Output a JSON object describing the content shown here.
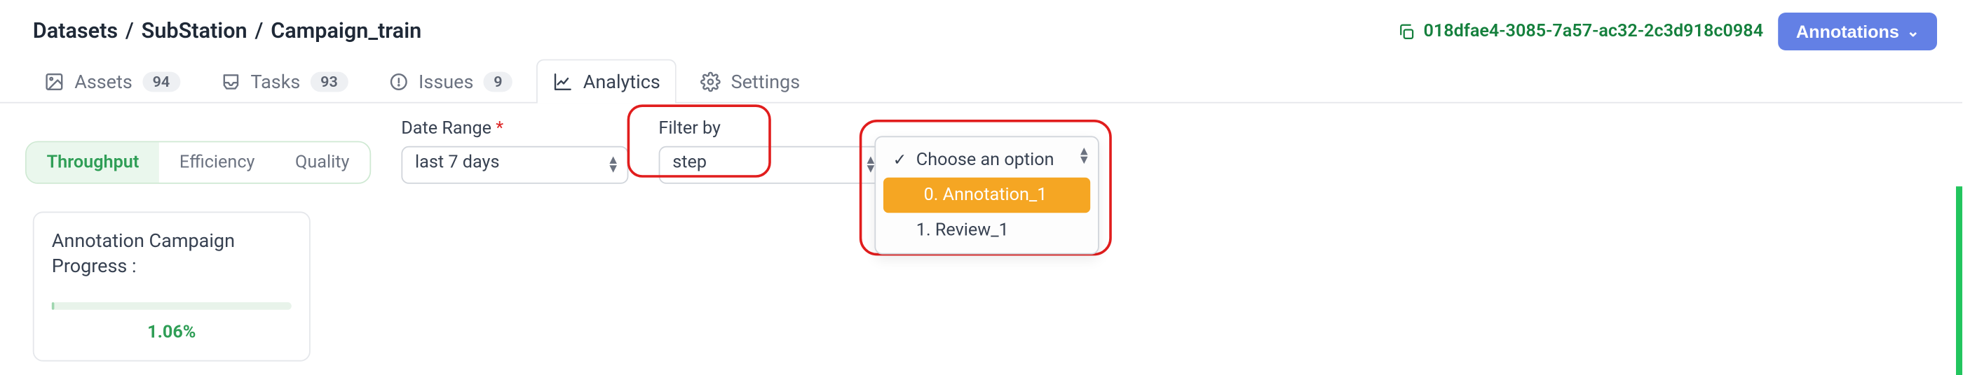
{
  "breadcrumb": {
    "root": "Datasets",
    "mid": "SubStation",
    "leaf": "Campaign_train"
  },
  "header": {
    "uuid": "018dfae4-3085-7a57-ac32-2c3d918c0984",
    "annotations_btn": "Annotations"
  },
  "tabs": {
    "assets": {
      "label": "Assets",
      "count": "94"
    },
    "tasks": {
      "label": "Tasks",
      "count": "93"
    },
    "issues": {
      "label": "Issues",
      "count": "9"
    },
    "analytics": {
      "label": "Analytics"
    },
    "settings": {
      "label": "Settings"
    }
  },
  "seg": {
    "throughput": "Throughput",
    "efficiency": "Efficiency",
    "quality": "Quality"
  },
  "fields": {
    "date_label": "Date Range",
    "date_required": "*",
    "date_value": "last 7 days",
    "filter_label": "Filter by",
    "filter_value": "step"
  },
  "dropdown": {
    "choose": "Choose an option",
    "opt0": "0. Annotation_1",
    "opt1": "1. Review_1"
  },
  "card": {
    "title": "Annotation Campaign Progress :",
    "percent_text": "1.06%",
    "percent_value": 1.06
  }
}
